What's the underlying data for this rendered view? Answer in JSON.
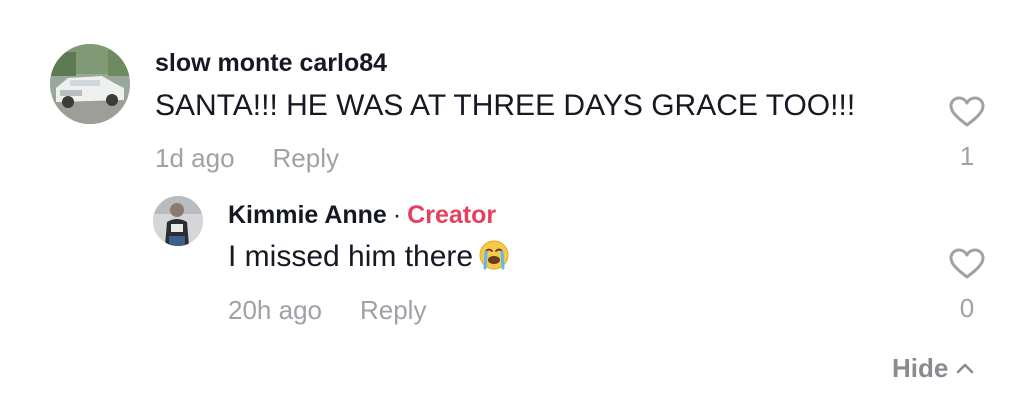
{
  "comments": [
    {
      "username": "slow monte carlo84",
      "avatar": "car-photo",
      "text": "SANTA!!! HE WAS AT THREE DAYS GRACE TOO!!!",
      "time": "1d ago",
      "reply_label": "Reply",
      "like_icon": "heart-outline-icon",
      "likes": "1",
      "replies": [
        {
          "username": "Kimmie Anne",
          "separator": "·",
          "badge": "Creator",
          "badge_color": "#e5405e",
          "avatar": "person-photo",
          "text": "I missed him there",
          "emoji": "loudly-crying-face",
          "time": "20h ago",
          "reply_label": "Reply",
          "like_icon": "heart-outline-icon",
          "likes": "0"
        }
      ]
    }
  ],
  "thread": {
    "hide_label": "Hide",
    "hide_icon": "chevron-up-icon"
  },
  "colors": {
    "text_primary": "#161823",
    "text_secondary": "#a0a1a6",
    "creator": "#e5405e"
  }
}
